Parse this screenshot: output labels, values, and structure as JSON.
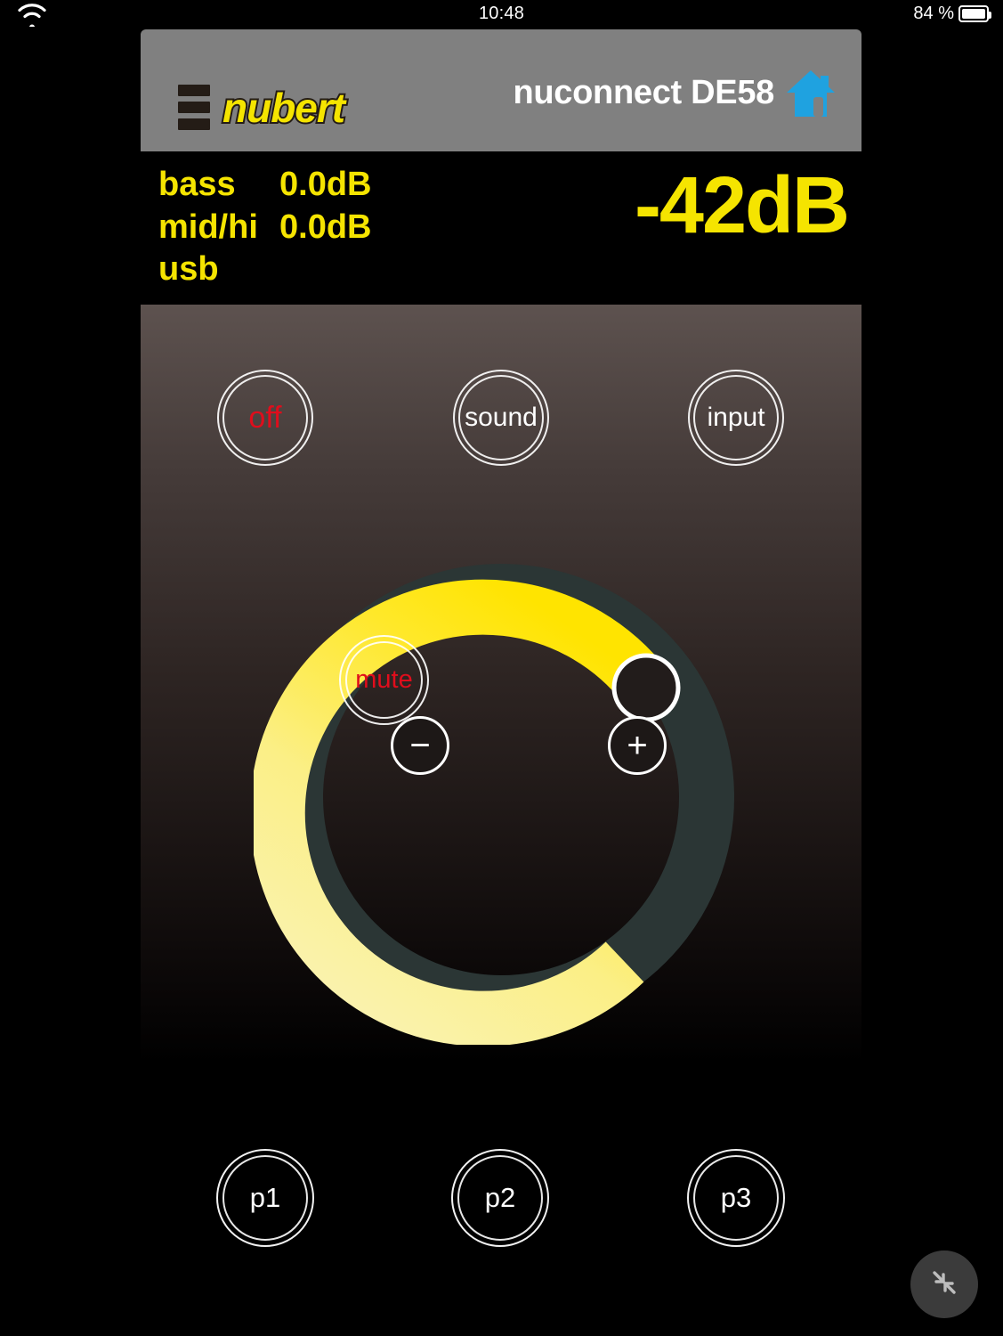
{
  "statusbar": {
    "time": "10:48",
    "battery_text": "84 %",
    "wifi_icon": "wifi-icon",
    "battery_icon": "battery-icon"
  },
  "header": {
    "brand": "nubert",
    "brand_icon": "three-bars-icon",
    "device_name": "nuconnect DE58",
    "home_icon": "house-icon",
    "brand_color": "#f5e400",
    "bar_color": "#808080",
    "home_icon_color": "#1fa2e0"
  },
  "readout": {
    "params": [
      {
        "name": "bass",
        "value": "0.0dB"
      },
      {
        "name": "mid/hi",
        "value": "0.0dB"
      },
      {
        "name": "usb",
        "value": ""
      }
    ],
    "volume": "-42dB",
    "text_color": "#f5e400"
  },
  "controls": {
    "off_label": "off",
    "sound_label": "sound",
    "input_label": "input",
    "mute_label": "mute",
    "minus_label": "−",
    "plus_label": "+",
    "off_color": "#e00d1c",
    "mute_color": "#e00d1c"
  },
  "dial": {
    "active_color_start": "#ffe800",
    "active_color_end": "#f7f0a0",
    "track_color": "#2b3635",
    "knob_fill": "#221c1b",
    "knob_border": "#ffffff",
    "value_db": -42,
    "percent": 54,
    "start_angle_deg": 228,
    "sweep_deg": 194
  },
  "presets": {
    "items": [
      {
        "label": "p1"
      },
      {
        "label": "p2"
      },
      {
        "label": "p3"
      }
    ]
  },
  "fab": {
    "icon": "compress-arrows-icon"
  }
}
